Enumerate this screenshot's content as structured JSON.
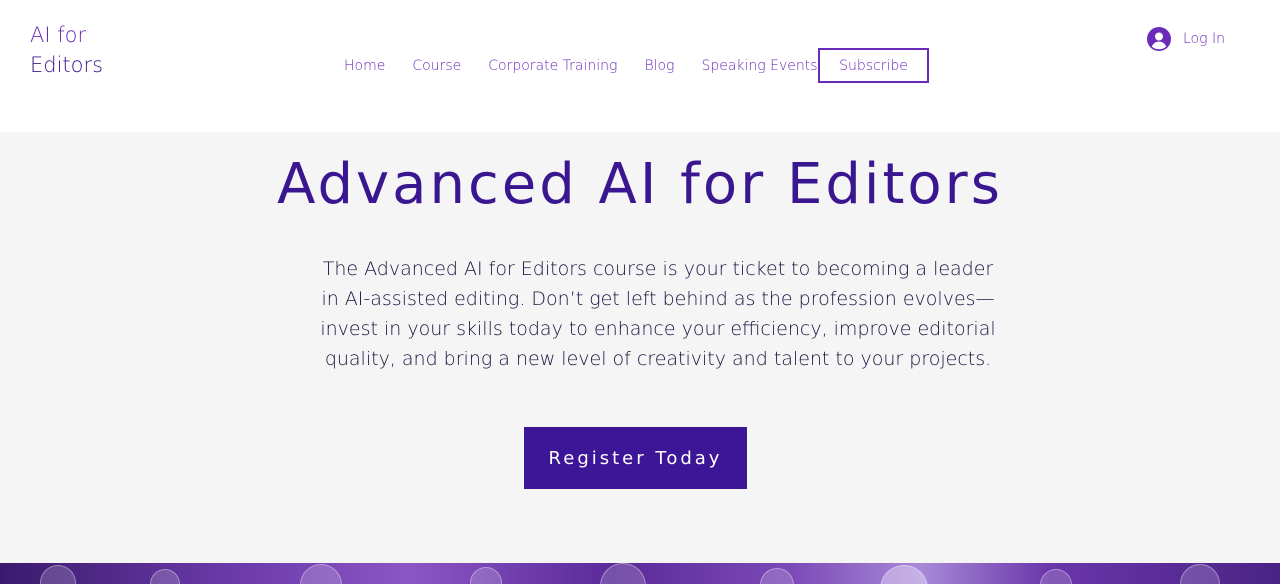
{
  "header": {
    "logo_line1": "AI for",
    "logo_line2": "Editors",
    "nav": [
      {
        "label": "Home"
      },
      {
        "label": "Course"
      },
      {
        "label": "Corporate Training"
      },
      {
        "label": "Blog"
      },
      {
        "label": "Speaking Events"
      }
    ],
    "subscribe_label": "Subscribe",
    "login_label": "Log In",
    "login_icon": "user-avatar-icon"
  },
  "hero": {
    "title": "Advanced AI for Editors",
    "description": "The Advanced AI for Editors course is your ticket to becoming a leader in AI-assisted editing. Don’t get left behind as the profession evolves—invest in your skills today to enhance your efficiency, improve editorial quality, and bring a new level of creativity and talent to your projects.",
    "cta_label": "Register Today"
  },
  "colors": {
    "accent": "#6a2bb8",
    "brand_dark": "#3a1790",
    "cta_bg": "#3c1696",
    "hero_bg": "#f5f5f5"
  }
}
